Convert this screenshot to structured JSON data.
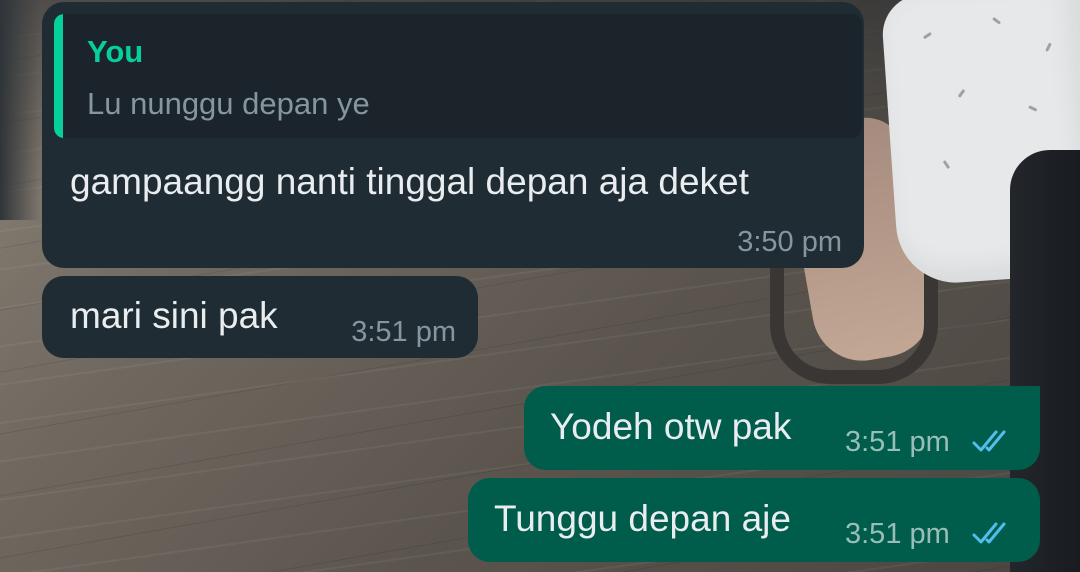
{
  "messages": [
    {
      "direction": "incoming",
      "quote": {
        "author": "You",
        "text": "Lu nunggu depan ye"
      },
      "text": "gampaangg nanti tinggal depan aja deket",
      "time": "3:50 pm"
    },
    {
      "direction": "incoming",
      "text": "mari sini pak",
      "time": "3:51 pm"
    },
    {
      "direction": "outgoing",
      "text": "Yodeh otw pak",
      "time": "3:51 pm",
      "status": "read-double-check-icon"
    },
    {
      "direction": "outgoing",
      "text": "Tunggu depan aje",
      "time": "3:51 pm",
      "status": "read-double-check-icon"
    }
  ],
  "colors": {
    "incoming_bubble": "#202c33",
    "outgoing_bubble": "#005c4b",
    "quote_accent": "#06cf9c",
    "read_ticks": "#53bdeb",
    "text": "#e9edef",
    "meta_text": "#8696a0"
  }
}
